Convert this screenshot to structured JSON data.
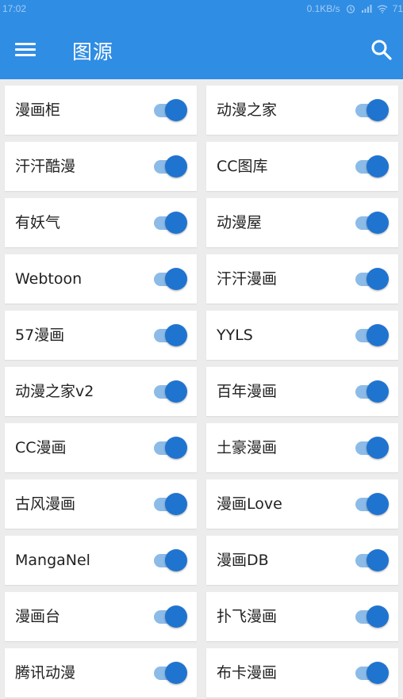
{
  "status_bar": {
    "time": "17:02",
    "net_speed": "0.1KB/s",
    "battery": "71"
  },
  "app_bar": {
    "title": "图源",
    "menu_icon": "menu-icon",
    "search_icon": "search-icon"
  },
  "colors": {
    "primary": "#2f8de4",
    "toggle_on_thumb": "#1f74d0",
    "toggle_on_track": "#8cbbe8",
    "background": "#ececec"
  },
  "sources": [
    {
      "left": {
        "label": "漫画柜",
        "enabled": true
      },
      "right": {
        "label": "动漫之家",
        "enabled": true
      }
    },
    {
      "left": {
        "label": "汗汗酷漫",
        "enabled": true
      },
      "right": {
        "label": "CC图库",
        "enabled": true
      }
    },
    {
      "left": {
        "label": "有妖气",
        "enabled": true
      },
      "right": {
        "label": "动漫屋",
        "enabled": true
      }
    },
    {
      "left": {
        "label": "Webtoon",
        "enabled": true
      },
      "right": {
        "label": "汗汗漫画",
        "enabled": true
      }
    },
    {
      "left": {
        "label": "57漫画",
        "enabled": true
      },
      "right": {
        "label": "YYLS",
        "enabled": true
      }
    },
    {
      "left": {
        "label": "动漫之家v2",
        "enabled": true
      },
      "right": {
        "label": "百年漫画",
        "enabled": true
      }
    },
    {
      "left": {
        "label": "CC漫画",
        "enabled": true
      },
      "right": {
        "label": "土豪漫画",
        "enabled": true
      }
    },
    {
      "left": {
        "label": "古风漫画",
        "enabled": true
      },
      "right": {
        "label": "漫画Love",
        "enabled": true
      }
    },
    {
      "left": {
        "label": "MangaNel",
        "enabled": true
      },
      "right": {
        "label": "漫画DB",
        "enabled": true
      }
    },
    {
      "left": {
        "label": "漫画台",
        "enabled": true
      },
      "right": {
        "label": "扑飞漫画",
        "enabled": true
      }
    },
    {
      "left": {
        "label": "腾讯动漫",
        "enabled": true
      },
      "right": {
        "label": "布卡漫画",
        "enabled": true
      }
    }
  ]
}
